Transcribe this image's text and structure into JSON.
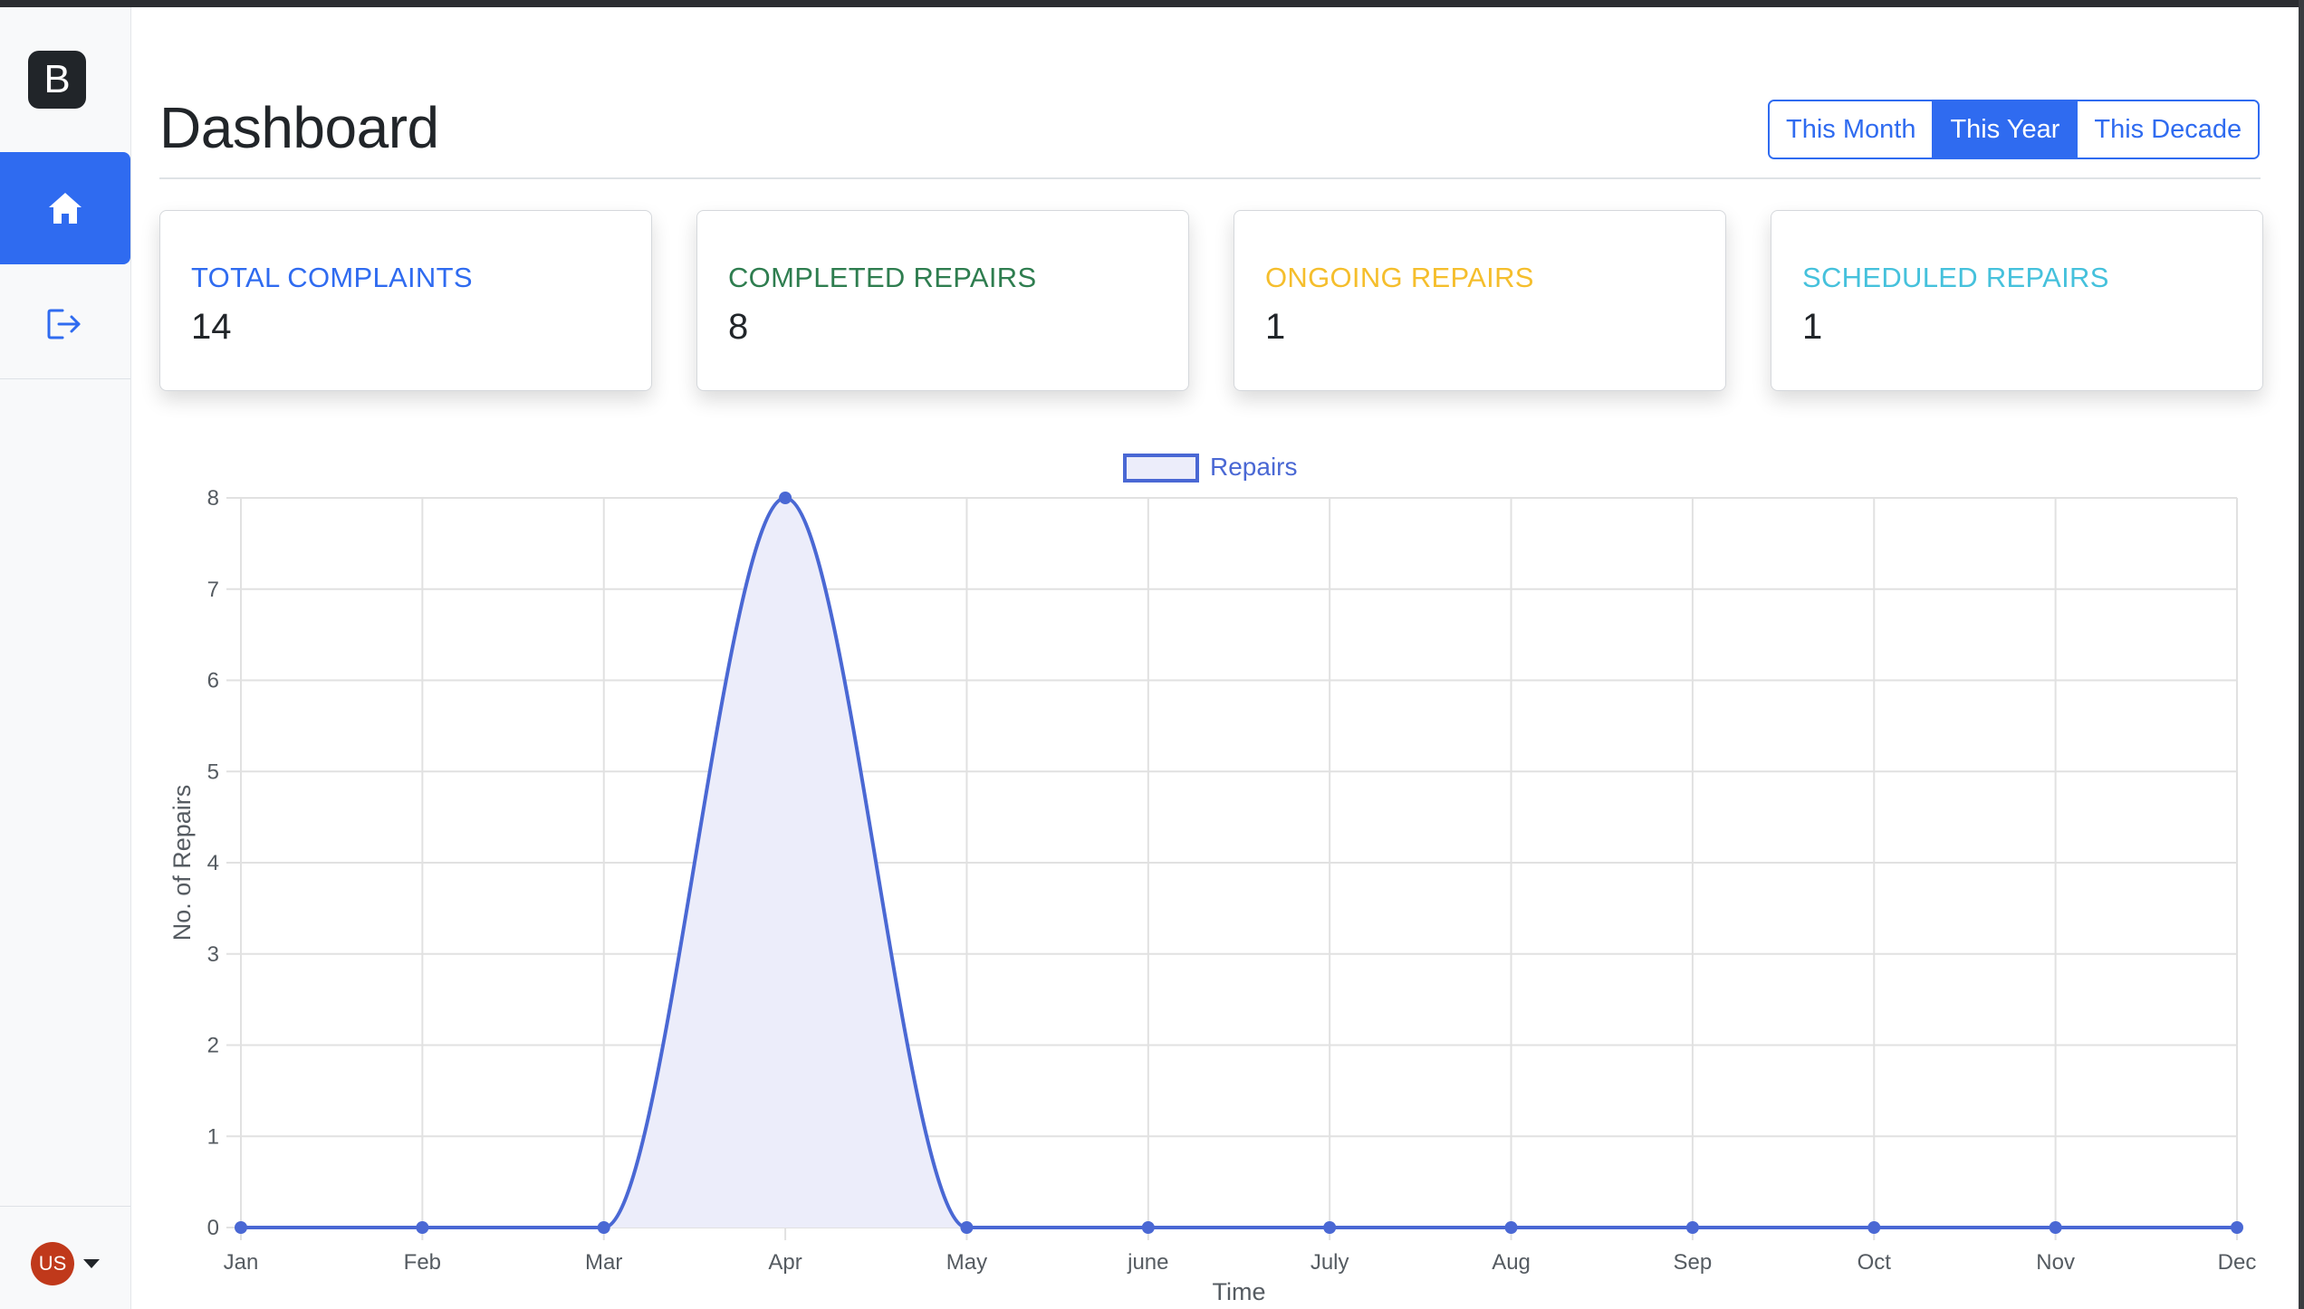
{
  "sidebar": {
    "brand_letter": "B",
    "items": [
      {
        "icon": "home-icon",
        "active": true
      },
      {
        "icon": "logout-icon",
        "active": false
      }
    ],
    "user": {
      "initials": "US",
      "avatar_color": "#c0391b"
    }
  },
  "header": {
    "title": "Dashboard",
    "range_buttons": [
      "This Month",
      "This Year",
      "This Decade"
    ],
    "active_range": "This Year"
  },
  "stats": [
    {
      "label": "TOTAL COMPLAINTS",
      "value": "14",
      "color": "#2f6bf0"
    },
    {
      "label": "COMPLETED REPAIRS",
      "value": "8",
      "color": "#2e7d4f"
    },
    {
      "label": "ONGOING REPAIRS",
      "value": "1",
      "color": "#f5be2c"
    },
    {
      "label": "SCHEDULED REPAIRS",
      "value": "1",
      "color": "#45c1dc"
    }
  ],
  "colors": {
    "accent": "#2f6bf0",
    "series": "#4a68d4",
    "series_fill": "#ecedfa"
  },
  "chart_data": {
    "type": "area",
    "categories": [
      "Jan",
      "Feb",
      "Mar",
      "Apr",
      "May",
      "june",
      "July",
      "Aug",
      "Sep",
      "Oct",
      "Nov",
      "Dec"
    ],
    "series": [
      {
        "name": "Repairs",
        "values": [
          0,
          0,
          0,
          8,
          0,
          0,
          0,
          0,
          0,
          0,
          0,
          0
        ]
      }
    ],
    "xlabel": "Time",
    "ylabel": "No. of Repairs",
    "ylim": [
      0,
      8
    ],
    "yticks": [
      "0",
      "1",
      "2",
      "3",
      "4",
      "5",
      "6",
      "7",
      "8"
    ],
    "grid": true,
    "legend": "top-center",
    "smooth": true
  }
}
